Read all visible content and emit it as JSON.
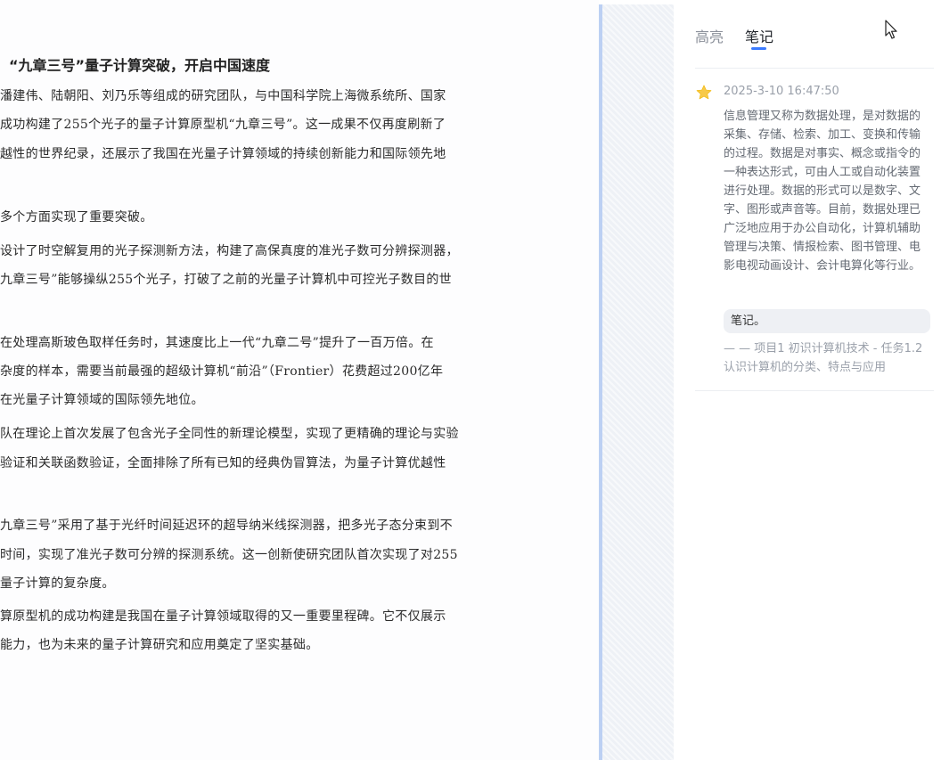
{
  "article": {
    "title": "“九章三号”量子计算突破，开启中国速度",
    "lines": [
      "潘建伟、陆朝阳、刘乃乐等组成的研究团队，与中国科学院上海微系统所、国家",
      "成功构建了255个光子的量子计算原型机“九章三号”。这一成果不仅再度刷新了",
      "越性的世界纪录，还展示了我国在光量子计算领域的持续创新能力和国际领先地",
      "多个方面实现了重要突破。",
      "设计了时空解复用的光子探测新方法，构建了高保真度的准光子数可分辨探测器，",
      "九章三号”能够操纵255个光子，打破了之前的光量子计算机中可控光子数目的世",
      "在处理高斯玻色取样任务时，其速度比上一代“九章二号”提升了一百万倍。在",
      "杂度的样本，需要当前最强的超级计算机“前沿”（Frontier）花费超过200亿年",
      "在光量子计算领域的国际领先地位。",
      "队在理论上首次发展了包含光子全同性的新理论模型，实现了更精确的理论与实验",
      "验证和关联函数验证，全面排除了所有已知的经典伪冒算法，为量子计算优越性",
      "九章三号”采用了基于光纤时间延迟环的超导纳米线探测器，把多光子态分束到不",
      "时间，实现了准光子数可分辨的探测系统。这一创新使研究团队首次实现了对255",
      "量子计算的复杂度。",
      "算原型机的成功构建是我国在量子计算领域取得的又一重要里程碑。它不仅展示",
      "能力，也为未来的量子计算研究和应用奠定了坚实基础。"
    ]
  },
  "panel": {
    "tabs": [
      {
        "label": "高亮"
      },
      {
        "label": "笔记"
      }
    ],
    "note": {
      "timestamp": "2025-3-10 16:47:50",
      "content": "信息管理又称为数据处理，是对数据的采集、存储、检索、加工、变换和传输的过程。数据是对事实、概念或指令的一种表达形式，可由人工或自动化装置进行处理。数据的形式可以是数字、文字、图形或声音等。目前，数据处理已广泛地应用于办公自动化，计算机辅助管理与决策、情报检索、图书管理、电影电视动画设计、会计电算化等行业。",
      "tag": "笔记。",
      "source": "— — 项目1 初识计算机技术 - 任务1.2 认识计算机的分类、特点与应用"
    }
  },
  "colors": {
    "accent": "#3a7afe",
    "divider": "#bcd0f3",
    "star": "#f7c948"
  },
  "icons": {
    "favorite": "star-icon",
    "pointer": "cursor-icon"
  }
}
